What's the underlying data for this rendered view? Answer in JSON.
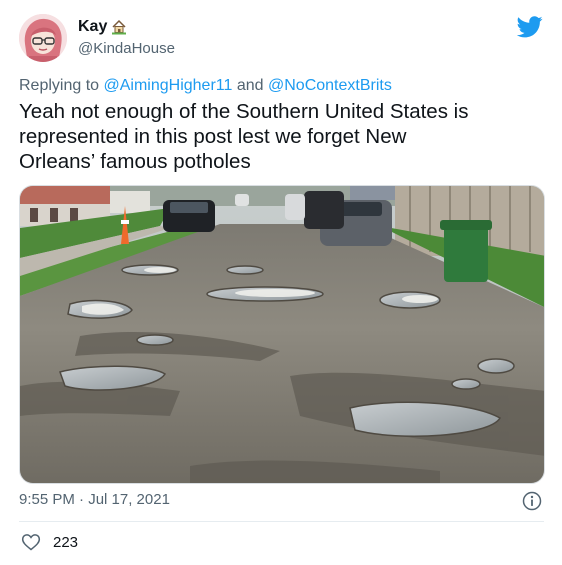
{
  "author": {
    "display_name": "Kay",
    "handle": "@KindaHouse",
    "name_emoji": "house-with-garden-icon"
  },
  "reply": {
    "prefix": "Replying to",
    "mention_1": "@AimingHigher11",
    "joiner": "and",
    "mention_2": "@NoContextBrits"
  },
  "tweet": {
    "line_1": "Yeah not enough of the Southern United States is",
    "line_2": "represented in this post lest we forget New",
    "line_3": "Orleans’ famous potholes"
  },
  "meta": {
    "timestamp": "9:55 PM · Jul 17, 2021"
  },
  "engagement": {
    "likes": "223"
  },
  "colors": {
    "accent": "#1d9bf0",
    "secondary_text": "#536471",
    "text": "#0f1419"
  },
  "icons": {
    "logo": "twitter-bird-icon",
    "info": "info-icon",
    "like": "heart-icon"
  }
}
